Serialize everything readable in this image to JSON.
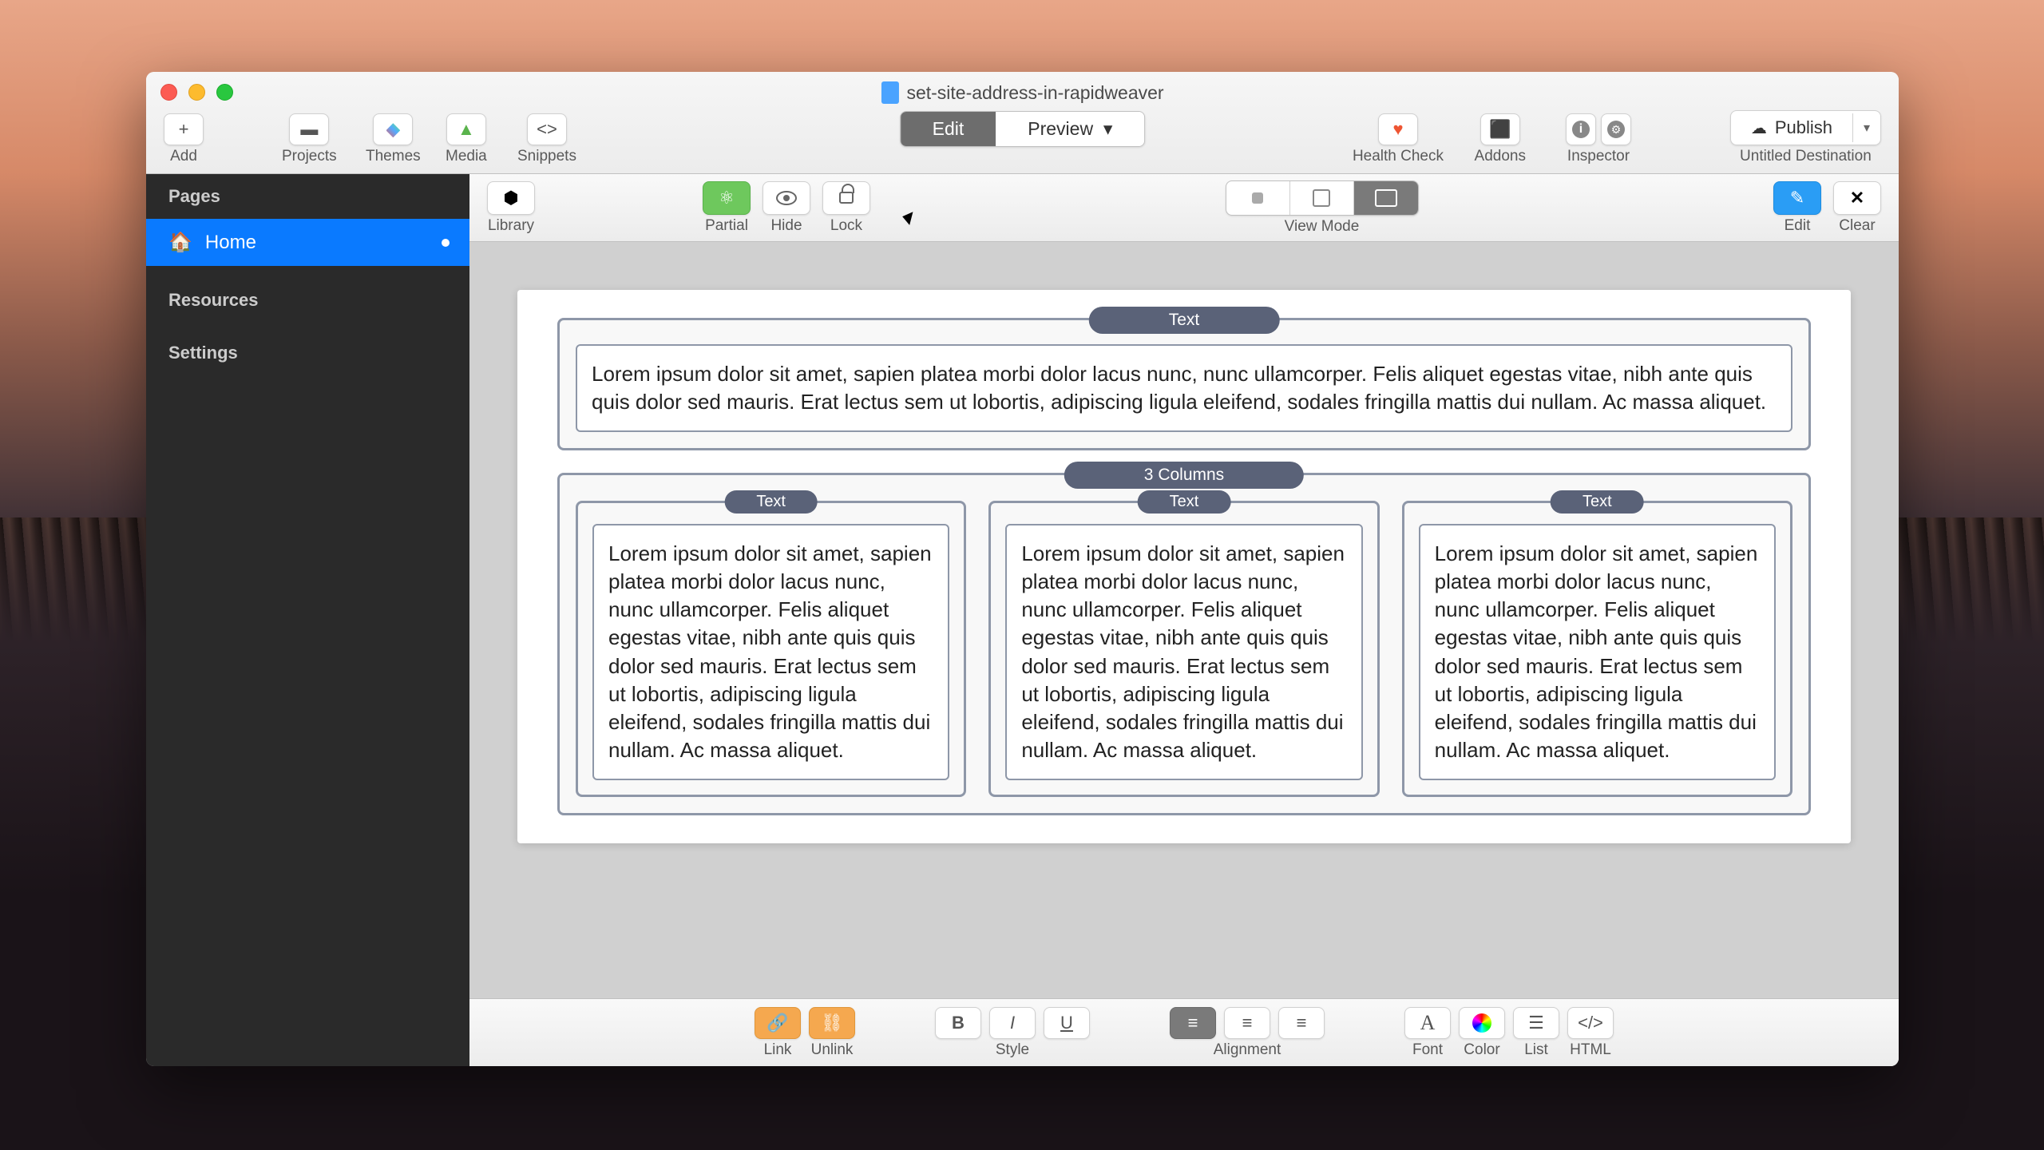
{
  "window": {
    "title": "set-site-address-in-rapidweaver"
  },
  "toolbar": {
    "add": "Add",
    "projects": "Projects",
    "themes": "Themes",
    "media": "Media",
    "snippets": "Snippets",
    "edit": "Edit",
    "preview": "Preview",
    "health_check": "Health Check",
    "addons": "Addons",
    "inspector": "Inspector",
    "publish": "Publish",
    "destination": "Untitled Destination"
  },
  "sidebar": {
    "pages_header": "Pages",
    "home": "Home",
    "resources": "Resources",
    "settings": "Settings"
  },
  "sec_toolbar": {
    "library": "Library",
    "partial": "Partial",
    "hide": "Hide",
    "lock": "Lock",
    "view_mode": "View Mode",
    "edit": "Edit",
    "clear": "Clear"
  },
  "canvas": {
    "text_label": "Text",
    "columns_label": "3 Columns",
    "lorem_full": "Lorem ipsum dolor sit amet, sapien platea morbi dolor lacus nunc, nunc ullamcorper. Felis aliquet egestas vitae, nibh ante quis quis dolor sed mauris. Erat lectus sem ut lobortis, adipiscing ligula eleifend, sodales fringilla mattis dui nullam. Ac massa aliquet.",
    "lorem_col": "Lorem ipsum dolor sit amet, sapien platea morbi dolor lacus nunc, nunc ullamcorper. Felis aliquet egestas vitae, nibh ante quis quis dolor sed mauris. Erat lectus sem ut lobortis, adipiscing ligula eleifend, sodales fringilla mattis dui nullam. Ac massa aliquet."
  },
  "bottom": {
    "link": "Link",
    "unlink": "Unlink",
    "style": "Style",
    "alignment": "Alignment",
    "font": "Font",
    "color": "Color",
    "list": "List",
    "html": "HTML"
  }
}
